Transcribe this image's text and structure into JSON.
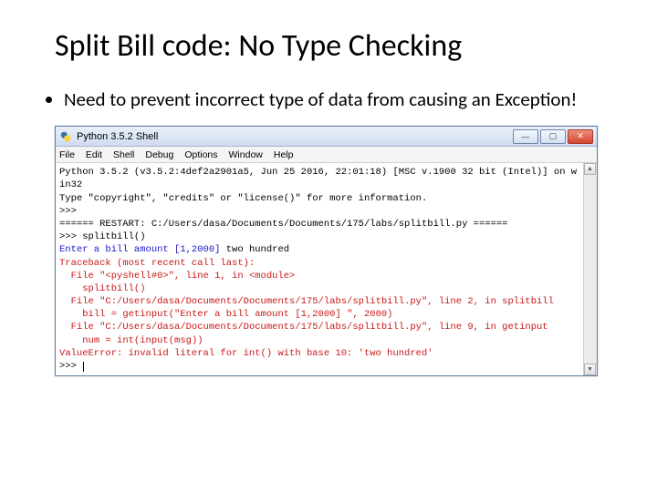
{
  "slide": {
    "title": "Split Bill code: No Type Checking",
    "bullet": "Need to prevent incorrect type of data from causing an Exception!"
  },
  "window": {
    "app_title": "Python 3.5.2 Shell",
    "menu": {
      "file": "File",
      "edit": "Edit",
      "shell": "Shell",
      "debug": "Debug",
      "options": "Options",
      "window": "Window",
      "help": "Help"
    }
  },
  "shell": {
    "banner1": "Python 3.5.2 (v3.5.2:4def2a2901a5, Jun 25 2016, 22:01:18) [MSC v.1900 32 bit (Intel)] on win32",
    "banner2": "Type \"copyright\", \"credits\" or \"license()\" for more information.",
    "prompt1": ">>>",
    "restart": "====== RESTART: C:/Users/dasa/Documents/Documents/175/labs/splitbill.py ======",
    "call": ">>> splitbill()",
    "input_prompt": "Enter a bill amount [1,2000]",
    "input_value": " two hundred",
    "tb1": "Traceback (most recent call last):",
    "tb2": "  File \"<pyshell#0>\", line 1, in <module>",
    "tb3": "    splitbill()",
    "tb4": "  File \"C:/Users/dasa/Documents/Documents/175/labs/splitbill.py\", line 2, in splitbill",
    "tb5": "    bill = getinput(\"Enter a bill amount [1,2000] \", 2000)",
    "tb6": "  File \"C:/Users/dasa/Documents/Documents/175/labs/splitbill.py\", line 9, in getinput",
    "tb7": "    num = int(input(msg))",
    "err": "ValueError: invalid literal for int() with base 10: 'two hundred'",
    "prompt_end": ">>> "
  }
}
